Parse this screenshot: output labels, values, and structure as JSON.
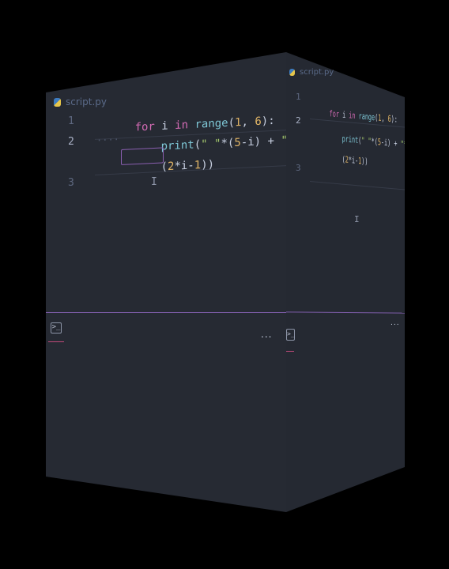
{
  "editor": {
    "tab_label": "script.py",
    "file_icon": "python-icon",
    "line_numbers": [
      "1",
      "2",
      "3"
    ],
    "lines": {
      "line1": {
        "kw": "for",
        "var": " i ",
        "kw2": "in",
        "fn": " range",
        "open": "(",
        "n1": "1",
        "comma": ", ",
        "n2": "6",
        "close": "):"
      },
      "line2": {
        "fn": "print",
        "open": "(",
        "s1": "\" \"",
        "op1": "*(",
        "n1": "5",
        "mid": "-i) + ",
        "s2": "\"*\"",
        "op2": "*"
      },
      "line2b": {
        "open": "(",
        "n1": "2",
        "mid": "*i-",
        "n2": "1",
        "close1": ")",
        "close2": ")"
      }
    }
  },
  "panel": {
    "terminal_icon_label": ">_",
    "more_actions": "...",
    "terminal_icon": "terminal-icon"
  },
  "colors": {
    "background": "#000000",
    "editor_bg": "#262a33",
    "keyword": "#d36bb4",
    "function": "#7ec7d6",
    "number": "#e0b466",
    "string": "#a4c86c",
    "accent_separator": "#7d5ca8"
  }
}
